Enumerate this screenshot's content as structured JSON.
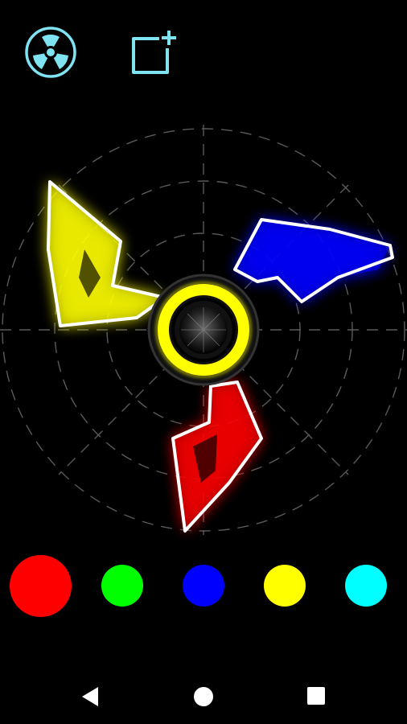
{
  "toolbar": {
    "spinner_icon": "fidget-spinner-icon",
    "new_icon": "new-canvas-plus-icon",
    "icon_color": "#7fe3f2"
  },
  "spinner": {
    "arms": [
      {
        "name": "yellow-arm",
        "color": "#ffff00"
      },
      {
        "name": "blue-arm",
        "color": "#0000ff"
      },
      {
        "name": "red-arm",
        "color": "#ff0000"
      }
    ],
    "hub_color": "#ffff00",
    "grid_color": "#555555"
  },
  "palette": {
    "selected": "red",
    "colors": [
      {
        "name": "red",
        "hex": "#ff0000"
      },
      {
        "name": "green",
        "hex": "#00ff00"
      },
      {
        "name": "blue",
        "hex": "#0000ff"
      },
      {
        "name": "yellow",
        "hex": "#ffff00"
      },
      {
        "name": "cyan",
        "hex": "#00ffff"
      }
    ]
  },
  "navbar": {
    "back_icon": "back-triangle-icon",
    "home_icon": "home-circle-icon",
    "recents_icon": "recents-square-icon"
  }
}
